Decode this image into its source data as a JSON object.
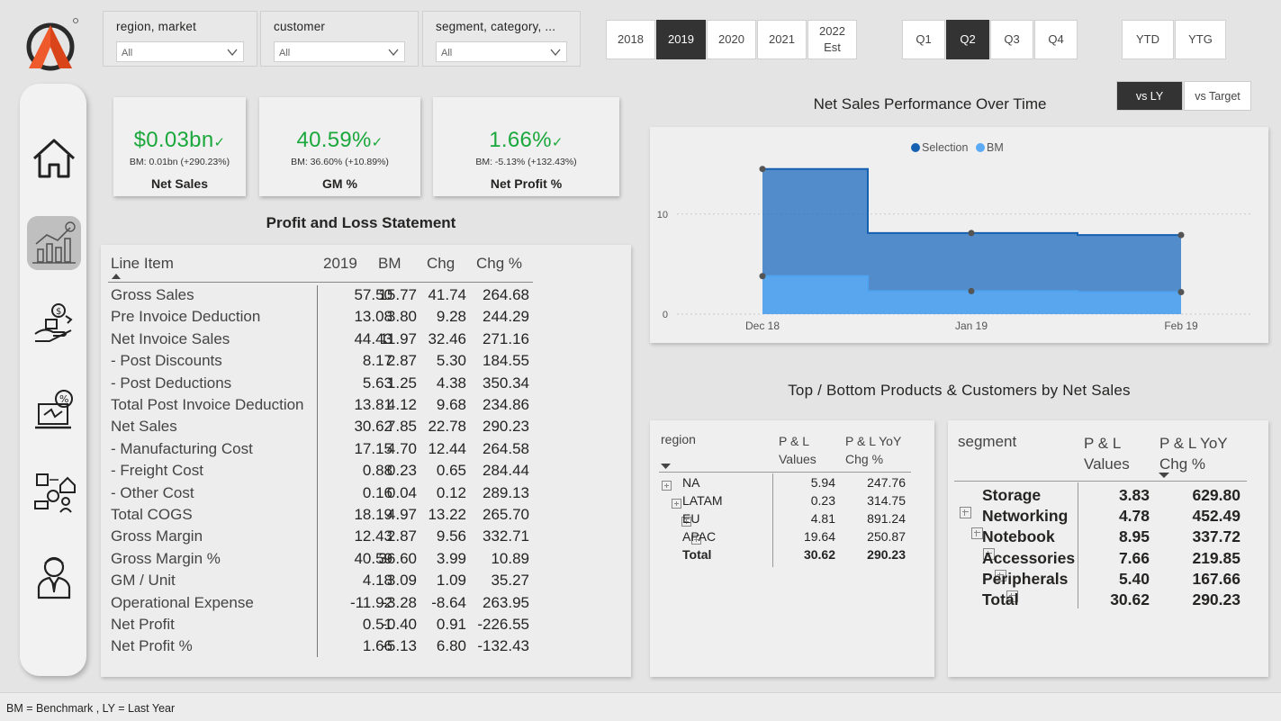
{
  "filters": [
    {
      "label": "region, market",
      "value": "All"
    },
    {
      "label": "customer",
      "value": "All"
    },
    {
      "label": "segment, category, ...",
      "value": "All"
    }
  ],
  "years": [
    {
      "label": "2018",
      "active": false
    },
    {
      "label": "2019",
      "active": true
    },
    {
      "label": "2020",
      "active": false
    },
    {
      "label": "2021",
      "active": false
    },
    {
      "label": "2022\nEst",
      "active": false
    }
  ],
  "quarters": [
    {
      "label": "Q1",
      "active": false
    },
    {
      "label": "Q2",
      "active": true
    },
    {
      "label": "Q3",
      "active": false
    },
    {
      "label": "Q4",
      "active": false
    }
  ],
  "periods": [
    {
      "label": "YTD"
    },
    {
      "label": "YTG"
    }
  ],
  "compare": [
    {
      "label": "vs LY",
      "active": true
    },
    {
      "label": "vs Target",
      "active": false
    }
  ],
  "kpis": [
    {
      "value": "$0.03bn",
      "bm": "BM: 0.01bn (+290.23%)",
      "title": "Net Sales"
    },
    {
      "value": "40.59%",
      "bm": "BM: 36.60% (+10.89%)",
      "title": "GM %"
    },
    {
      "value": "1.66%",
      "bm": "BM: -5.13% (+132.43%)",
      "title": "Net Profit %"
    }
  ],
  "pl": {
    "title": "Profit and Loss Statement",
    "headers": [
      "Line Item",
      "2019",
      "BM",
      "Chg",
      "Chg %"
    ],
    "rows": [
      [
        "Gross Sales",
        "57.50",
        "15.77",
        "41.74",
        "264.68"
      ],
      [
        "Pre Invoice Deduction",
        "13.08",
        "3.80",
        "9.28",
        "244.29"
      ],
      [
        "Net Invoice Sales",
        "44.43",
        "11.97",
        "32.46",
        "271.16"
      ],
      [
        "- Post Discounts",
        "8.17",
        "2.87",
        "5.30",
        "184.55"
      ],
      [
        "- Post Deductions",
        "5.63",
        "1.25",
        "4.38",
        "350.34"
      ],
      [
        "Total Post Invoice Deduction",
        "13.81",
        "4.12",
        "9.68",
        "234.86"
      ],
      [
        "Net Sales",
        "30.62",
        "7.85",
        "22.78",
        "290.23"
      ],
      [
        "- Manufacturing Cost",
        "17.15",
        "4.70",
        "12.44",
        "264.58"
      ],
      [
        "- Freight Cost",
        "0.88",
        "0.23",
        "0.65",
        "284.44"
      ],
      [
        "- Other Cost",
        "0.16",
        "0.04",
        "0.12",
        "289.13"
      ],
      [
        "Total COGS",
        "18.19",
        "4.97",
        "13.22",
        "265.70"
      ],
      [
        "Gross Margin",
        "12.43",
        "2.87",
        "9.56",
        "332.71"
      ],
      [
        "Gross Margin %",
        "40.59",
        "36.60",
        "3.99",
        "10.89"
      ],
      [
        "GM / Unit",
        "4.18",
        "3.09",
        "1.09",
        "35.27"
      ],
      [
        "Operational Expense",
        "-11.92",
        "-3.28",
        "-8.64",
        "263.95"
      ],
      [
        "Net Profit",
        "0.51",
        "-0.40",
        "0.91",
        "-226.55"
      ],
      [
        "Net Profit %",
        "1.66",
        "-5.13",
        "6.80",
        "-132.43"
      ]
    ]
  },
  "chart_data": {
    "type": "area",
    "title": "Net Sales Performance Over Time",
    "x": [
      "Dec 18",
      "Jan 19",
      "Feb 19"
    ],
    "series": [
      {
        "name": "Selection",
        "values": [
          14.5,
          8.1,
          7.9
        ],
        "color": "#1f6bbf"
      },
      {
        "name": "BM",
        "values": [
          3.8,
          2.3,
          2.2
        ],
        "color": "#5aaaf5"
      }
    ],
    "yticks": [
      "0",
      "10"
    ],
    "ylim": [
      0,
      16
    ],
    "legend": "top-center"
  },
  "section_title": "Top / Bottom Products  & Customers by Net Sales",
  "region_table": {
    "headers": [
      "region",
      "P & L Values",
      "P & L YoY Chg %"
    ],
    "rows": [
      [
        "NA",
        "5.94",
        "247.76"
      ],
      [
        "LATAM",
        "0.23",
        "314.75"
      ],
      [
        "EU",
        "4.81",
        "891.24"
      ],
      [
        "APAC",
        "19.64",
        "250.87"
      ]
    ],
    "total": [
      "Total",
      "30.62",
      "290.23"
    ]
  },
  "segment_table": {
    "headers": [
      "segment",
      "P & L Values",
      "P & L YoY Chg %"
    ],
    "rows": [
      [
        "Storage",
        "3.83",
        "629.80"
      ],
      [
        "Networking",
        "4.78",
        "452.49"
      ],
      [
        "Notebook",
        "8.95",
        "337.72"
      ],
      [
        "Accessories",
        "7.66",
        "219.85"
      ],
      [
        "Peripherals",
        "5.40",
        "167.66"
      ]
    ],
    "total": [
      "Total",
      "30.62",
      "290.23"
    ]
  },
  "footer": "BM = Benchmark , LY = Last Year",
  "colors": {
    "accent_green": "#1aa83c",
    "selection": "#1f6bbf",
    "bm": "#5aaaf5"
  }
}
